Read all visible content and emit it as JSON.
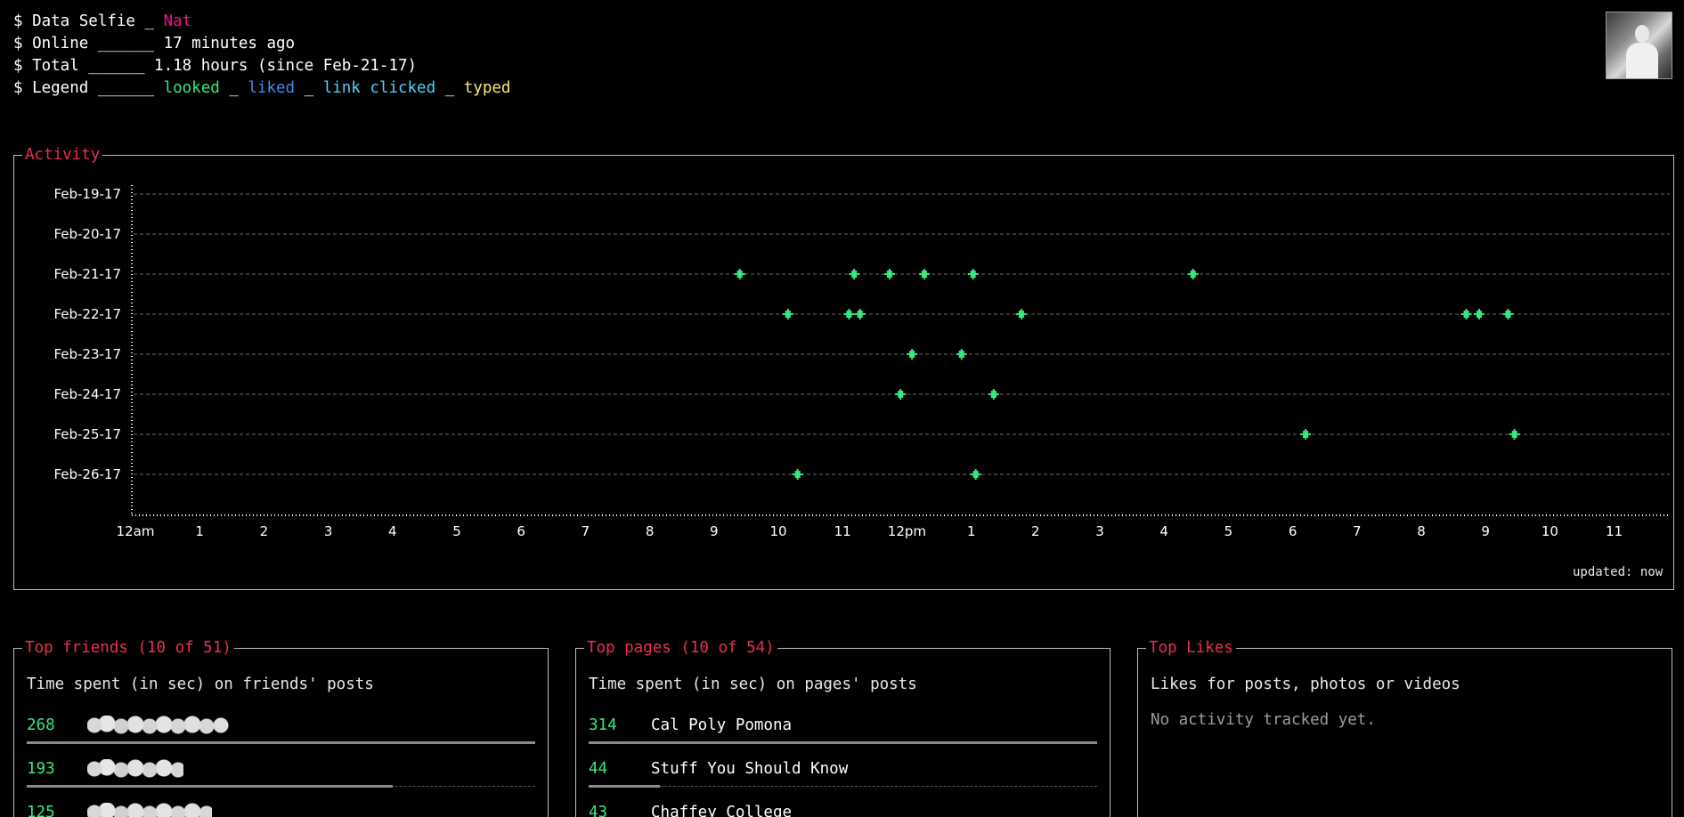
{
  "header": {
    "lines": [
      {
        "prompt": "$ Data Selfie _ ",
        "value": "Nat"
      },
      {
        "prompt": "$ Online ______ ",
        "value": "17 minutes ago"
      },
      {
        "prompt": "$ Total ______ ",
        "value": "1.18 hours (since Feb-21-17)"
      }
    ],
    "legend_prompt": "$ Legend ______ ",
    "legend": {
      "looked": "looked",
      "sep1": " _ ",
      "liked": "liked",
      "sep2": " _ ",
      "link_clicked": "link clicked",
      "sep3": " _ ",
      "typed": "typed"
    }
  },
  "colors": {
    "looked": "#36e87e",
    "liked": "#3f8cf2",
    "link_clicked": "#4fd4f5",
    "typed": "#f6ec6a",
    "name": "#e8178a",
    "panel_title": "#ea2f4d"
  },
  "activity": {
    "title": "Activity",
    "updated": "updated: now"
  },
  "chart_data": {
    "type": "scatter",
    "title": "Activity",
    "categories": [
      "Feb-19-17",
      "Feb-20-17",
      "Feb-21-17",
      "Feb-22-17",
      "Feb-23-17",
      "Feb-24-17",
      "Feb-25-17",
      "Feb-26-17"
    ],
    "x_ticks": [
      "12am",
      "1",
      "2",
      "3",
      "4",
      "5",
      "6",
      "7",
      "8",
      "9",
      "10",
      "11",
      "12pm",
      "1",
      "2",
      "3",
      "4",
      "5",
      "6",
      "7",
      "8",
      "9",
      "10",
      "11"
    ],
    "xlim": [
      0,
      24
    ],
    "grid": true,
    "series": [
      {
        "name": "looked",
        "points": [
          {
            "day": "Feb-21-17",
            "hour": 9.4
          },
          {
            "day": "Feb-21-17",
            "hour": 11.18
          },
          {
            "day": "Feb-21-17",
            "hour": 11.73
          },
          {
            "day": "Feb-21-17",
            "hour": 12.27
          },
          {
            "day": "Feb-21-17",
            "hour": 13.03
          },
          {
            "day": "Feb-21-17",
            "hour": 16.45
          },
          {
            "day": "Feb-22-17",
            "hour": 10.15
          },
          {
            "day": "Feb-22-17",
            "hour": 11.1
          },
          {
            "day": "Feb-22-17",
            "hour": 11.27
          },
          {
            "day": "Feb-22-17",
            "hour": 13.78
          },
          {
            "day": "Feb-22-17",
            "hour": 20.7
          },
          {
            "day": "Feb-22-17",
            "hour": 20.9
          },
          {
            "day": "Feb-22-17",
            "hour": 21.35
          },
          {
            "day": "Feb-23-17",
            "hour": 12.08
          },
          {
            "day": "Feb-23-17",
            "hour": 12.85
          },
          {
            "day": "Feb-24-17",
            "hour": 11.9
          },
          {
            "day": "Feb-24-17",
            "hour": 13.35
          },
          {
            "day": "Feb-25-17",
            "hour": 18.2
          },
          {
            "day": "Feb-25-17",
            "hour": 21.45
          },
          {
            "day": "Feb-26-17",
            "hour": 10.3
          },
          {
            "day": "Feb-26-17",
            "hour": 13.07
          }
        ]
      }
    ]
  },
  "friends": {
    "title": "Top friends (10 of 51)",
    "subtitle": "Time spent (in sec) on friends' posts",
    "rows": [
      {
        "value": "268",
        "name": "",
        "pct": 1.0
      },
      {
        "value": "193",
        "name": "",
        "pct": 0.72
      },
      {
        "value": "125",
        "name": "",
        "pct": 0.47
      }
    ]
  },
  "pages": {
    "title": "Top pages (10 of 54)",
    "subtitle": "Time spent (in sec) on pages' posts",
    "rows": [
      {
        "value": "314",
        "name": "Cal Poly Pomona",
        "pct": 1.0
      },
      {
        "value": "44",
        "name": "Stuff You Should Know",
        "pct": 0.14
      },
      {
        "value": "43",
        "name": "Chaffey College",
        "pct": 0.14
      }
    ]
  },
  "likes": {
    "title": "Top Likes",
    "subtitle": "Likes for posts, photos or videos",
    "empty": "No activity tracked yet."
  }
}
